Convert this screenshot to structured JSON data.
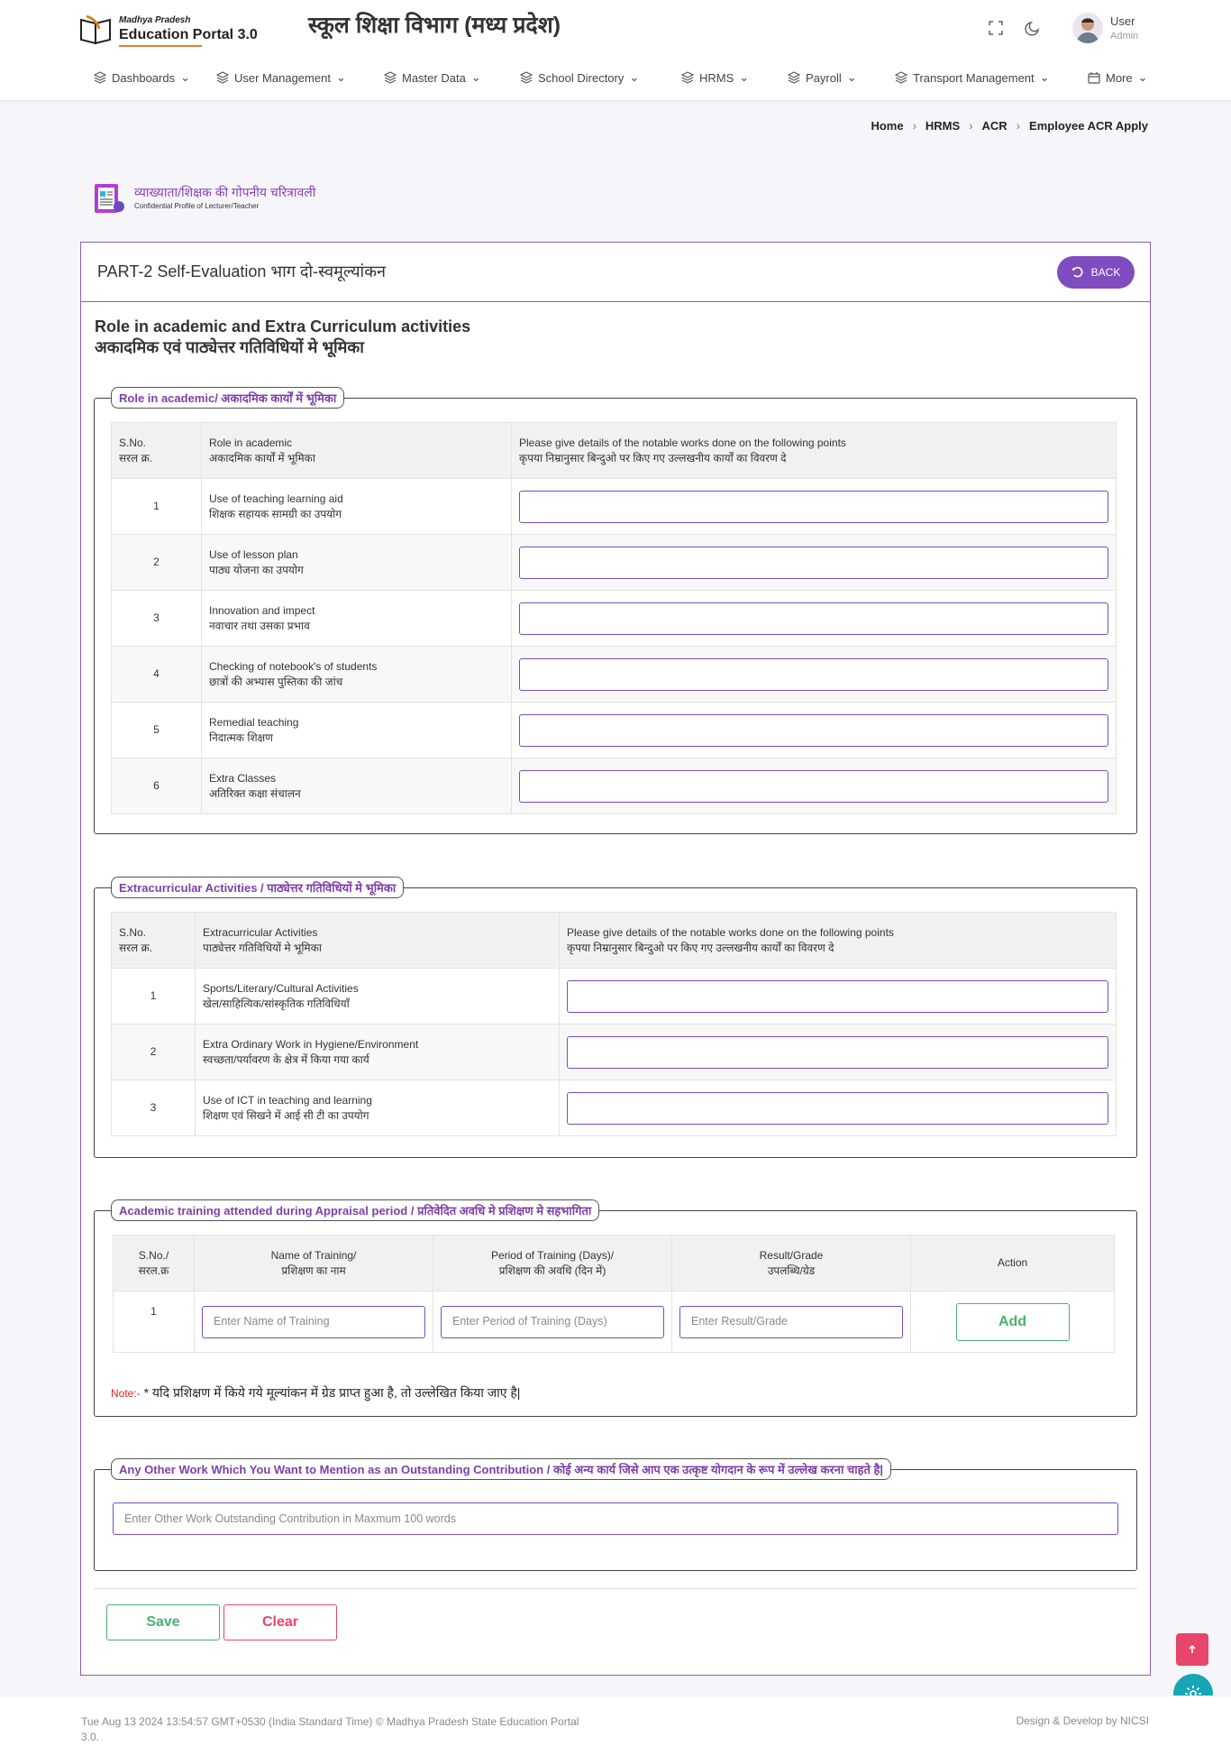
{
  "header": {
    "logo_small": "Madhya Pradesh",
    "logo_big": "Education Portal 3.0",
    "department_title": "स्कूल शिक्षा विभाग (मध्य प्रदेश)",
    "user_name": "User",
    "user_role": "Admin"
  },
  "nav": [
    {
      "label": "Dashboards",
      "icon": "layers-icon"
    },
    {
      "label": "User Management",
      "icon": "layers-icon"
    },
    {
      "label": "Master Data",
      "icon": "layers-icon"
    },
    {
      "label": "School Directory",
      "icon": "layers-icon"
    },
    {
      "label": "HRMS",
      "icon": "layers-icon"
    },
    {
      "label": "Payroll",
      "icon": "layers-icon"
    },
    {
      "label": "Transport Management",
      "icon": "layers-icon"
    },
    {
      "label": "More",
      "icon": "calendar-icon"
    }
  ],
  "breadcrumb": [
    "Home",
    "HRMS",
    "ACR",
    "Employee ACR Apply"
  ],
  "acr_logo": {
    "title": "व्याख्याता/शिक्षक की गोपनीय चरित्रावली",
    "subtitle": "Confidential Profile of Lecturer/Teacher"
  },
  "card": {
    "title": "PART-2 Self-Evaluation भाग दो-स्वमूल्यांकन",
    "back_label": "BACK",
    "section_title_en": "Role in academic and Extra Curriculum activities",
    "section_title_hi": "अकादमिक एवं पाठ्येत्तर गतिविधियों मे भूमिका"
  },
  "academic": {
    "legend": "Role in academic/ अकादमिक कार्यों में भूमिका",
    "headers": [
      [
        "S.No.",
        "सरल क्र."
      ],
      [
        "Role in academic",
        "अकादमिक कार्यों में भूमिका"
      ],
      [
        "Please give details of the notable works done on the following points",
        "कृपया निम्रानुसार बिन्दुओ पर किए गए उल्लखनीय कार्यों का विवरण दे"
      ]
    ],
    "rows": [
      {
        "sn": "1",
        "en": "Use of teaching learning aid",
        "hi": "शिक्षक सहायक सामग्री का उपयोग"
      },
      {
        "sn": "2",
        "en": "Use of lesson plan",
        "hi": "पाठ्य योजना का उपयोग"
      },
      {
        "sn": "3",
        "en": "Innovation and impect",
        "hi": "नवाचार तथा उसका प्रभाव"
      },
      {
        "sn": "4",
        "en": "Checking of notebook's of students",
        "hi": "छात्रों की अभ्यास पुस्तिका की जांच"
      },
      {
        "sn": "5",
        "en": "Remedial teaching",
        "hi": "निदात्मक शिक्षण"
      },
      {
        "sn": "6",
        "en": "Extra Classes",
        "hi": "अतिरिक्त कक्षा संचालन"
      }
    ]
  },
  "extracurricular": {
    "legend": "Extracurricular Activities / पाठ्येत्तर गतिविधियों मे भूमिका",
    "headers": [
      [
        "S.No.",
        "सरल क्र."
      ],
      [
        "Extracurricular Activities",
        "पाठ्येत्तर गतिविधियों मे भूमिका"
      ],
      [
        "Please give details of the notable works done on the following points",
        "कृपया निम्रानुसार बिन्दुओ पर किए गए उल्लखनीय कार्यों का विवरण दे"
      ]
    ],
    "rows": [
      {
        "sn": "1",
        "en": "Sports/Literary/Cultural Activities",
        "hi": "खेल/साहित्यिक/सांस्कृतिक गतिविधियाँ"
      },
      {
        "sn": "2",
        "en": "Extra Ordinary Work in Hygiene/Environment",
        "hi": "स्वच्छता/पर्यावरण के क्षेत्र में किया गया कार्य"
      },
      {
        "sn": "3",
        "en": "Use of ICT in teaching and learning",
        "hi": "शिक्षण एवं सिखने में आई सी टी का उपयोग"
      }
    ]
  },
  "training": {
    "legend": "Academic training attended during Appraisal period / प्रतिवेदित अवधि मे प्रशिक्षण मे सहभागिता",
    "headers": [
      [
        "S.No./",
        "सरल.क्र"
      ],
      [
        "Name of Training/",
        "प्रशिक्षण का नाम"
      ],
      [
        "Period of Training (Days)/",
        "प्रशिक्षण की अवधि (दिन में)"
      ],
      [
        "Result/Grade",
        "उपलब्धि/ग्रेड"
      ],
      [
        "Action",
        ""
      ]
    ],
    "row_sn": "1",
    "name_placeholder": "Enter Name of Training",
    "period_placeholder": "Enter Period of Training (Days)",
    "result_placeholder": "Enter Result/Grade",
    "add_label": "Add",
    "note_label": "Note:-",
    "note_text": " * यदि प्रशिक्षण में किये गये मूल्यांकन में ग्रेड प्राप्त हुआ है, तो उल्लेखित किया जाए है|"
  },
  "contribution": {
    "legend": "Any Other Work Which You Want to Mention as an Outstanding Contribution / कोई अन्य कार्य जिसे आप एक उत्कृष्ट योगदान के रूप में उल्लेख करना चाहते है|",
    "placeholder": "Enter  Other Work Outstanding Contribution in Maxmum 100 words"
  },
  "actions": {
    "save_label": "Save",
    "clear_label": "Clear"
  },
  "footer": {
    "left": "Tue Aug 13 2024 13:54:57 GMT+0530 (India Standard Time) © Madhya Pradesh State Education Portal 3.0.",
    "right": "Design & Develop by NICSI"
  },
  "colors": {
    "accent": "#7e4cbf",
    "success": "#4cae72",
    "danger": "#e8456a",
    "teal": "#17a6b5"
  }
}
